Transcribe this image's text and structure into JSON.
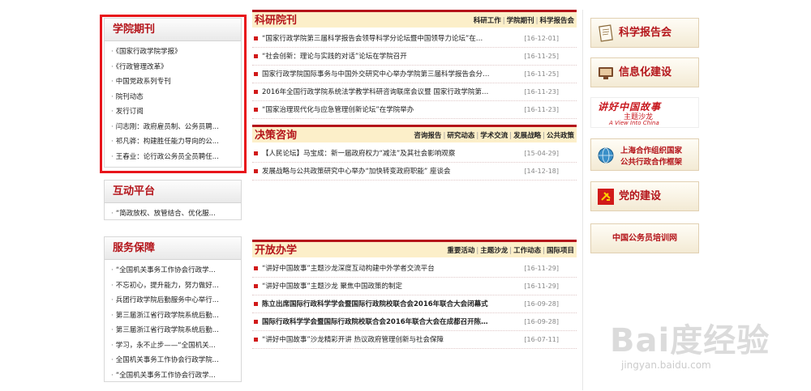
{
  "left": {
    "journals": {
      "title": "学院期刊",
      "items": [
        "《国家行政学院学报》",
        "《行政管理改革》",
        "中国党政系列专刊",
        "院刊动态",
        "发行订阅",
        "闫志刚：政府雇员制、公务员聘...",
        "祁凡骅：构建胜任能力导向的公...",
        "王春业：论行政公务员全员聘任..."
      ]
    },
    "platform": {
      "title": "互动平台",
      "items": [
        "“简政放权、放管结合、优化服..."
      ]
    },
    "service": {
      "title": "服务保障",
      "items": [
        "“全国机关事务工作协会行政学...",
        "不忘初心，提升能力，努力做好...",
        "兵团行政学院后勤服务中心举行...",
        "第三届浙江省行政学院系统后勤...",
        "第三届浙江省行政学院系统后勤...",
        "学习，永不止步——“全国机关...",
        "全国机关事务工作协会行政学院...",
        "“全国机关事务工作协会行政学..."
      ]
    }
  },
  "middle": {
    "research": {
      "title": "科研院刊",
      "links": [
        "科研工作",
        "学院期刊",
        "科学报告会"
      ],
      "items": [
        {
          "text": "“国家行政学院第三届科学报告会领导科学分论坛暨中国领导力论坛”在…",
          "date": "[16-12-01]",
          "bold": false
        },
        {
          "text": "“社会创新：理论与实践的对话”论坛在学院召开",
          "date": "[16-11-25]",
          "bold": false
        },
        {
          "text": "国家行政学院国际事务与中国外交研究中心举办学院第三届科学报告会分…",
          "date": "[16-11-25]",
          "bold": false
        },
        {
          "text": "2016年全国行政学院系统法学教学科研咨询联席会议暨 国家行政学院第…",
          "date": "[16-11-23]",
          "bold": false
        },
        {
          "text": "“国家治理现代化与应急管理创新论坛”在学院举办",
          "date": "[16-11-23]",
          "bold": false
        }
      ]
    },
    "decision": {
      "title": "决策咨询",
      "links": [
        "咨询报告",
        "研究动态",
        "学术交流",
        "发展战略",
        "公共政策"
      ],
      "items": [
        {
          "text": "【人民论坛】马宝成：新一届政府权力“减法”及其社会影响观察",
          "date": "[15-04-29]",
          "bold": false
        },
        {
          "text": "发展战略与公共政策研究中心举办“加快转变政府职能” 座谈会",
          "date": "[14-12-18]",
          "bold": false
        }
      ]
    },
    "opening": {
      "title": "开放办学",
      "links": [
        "重要活动",
        "主题沙龙",
        "工作动态",
        "国际项目"
      ],
      "items": [
        {
          "text": "“讲好中国故事”主题沙龙深度互动构建中外学者交流平台",
          "date": "[16-11-29]",
          "bold": false
        },
        {
          "text": "“讲好中国故事”主题沙龙 聚焦中国政策的制定",
          "date": "[16-11-29]",
          "bold": false
        },
        {
          "text": "陈立出席国际行政科学学会暨国际行政院校联合会2016年联合大会闭幕式",
          "date": "[16-09-28]",
          "bold": true
        },
        {
          "text": "国际行政科学学会暨国际行政院校联合会2016年联合大会在成都召开陈…",
          "date": "[16-09-28]",
          "bold": true
        },
        {
          "text": "“讲好中国故事”沙龙精彩开讲 热议政府管理创新与社会保障",
          "date": "[16-07-11]",
          "bold": false
        }
      ]
    }
  },
  "right": {
    "report": "科学报告会",
    "info": "信息化建设",
    "china_line1": "讲好中国故事",
    "china_line2": "主题沙龙",
    "china_line3": "A View Into China",
    "sco_line1": "上海合作组织国家",
    "sco_line2": "公共行政合作框架",
    "party": "党的建设",
    "civil": "中国公务员培训网"
  },
  "watermark": {
    "brand": "Bai度经验",
    "url": "jingyan.baidu.com"
  },
  "colors": {
    "accent": "#b4141a",
    "highlight_box": "#e8151b",
    "header_bg": "#fcefc9",
    "bullet": "#d11a1a"
  }
}
